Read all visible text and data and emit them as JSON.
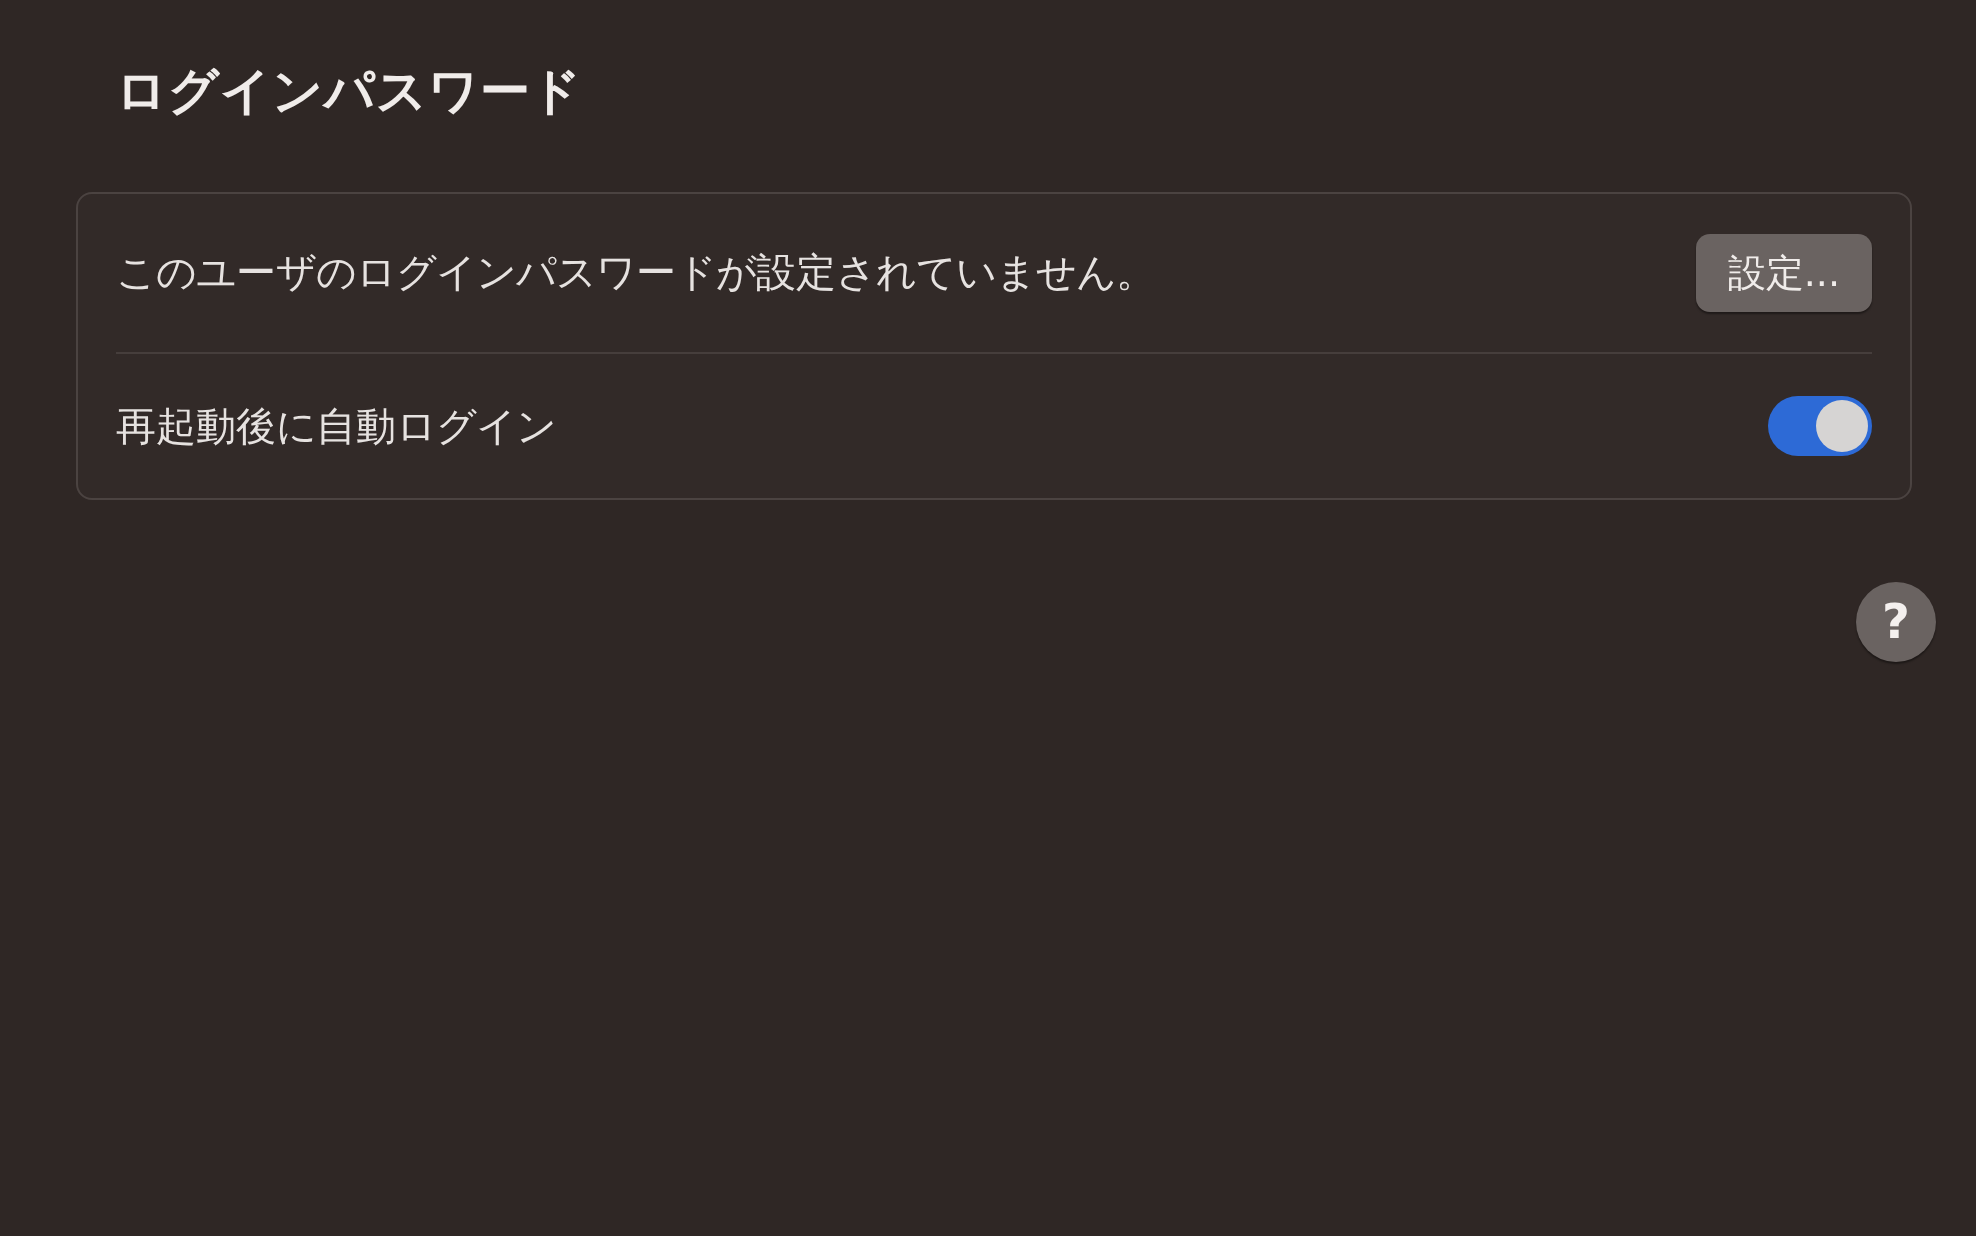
{
  "title": "ログインパスワード",
  "rows": [
    {
      "kind": "button",
      "label": "このユーザのログインパスワードが設定されていません。",
      "button": "設定..."
    },
    {
      "kind": "toggle",
      "label": "再起動後に自動ログイン",
      "on": true
    }
  ],
  "help": "?"
}
